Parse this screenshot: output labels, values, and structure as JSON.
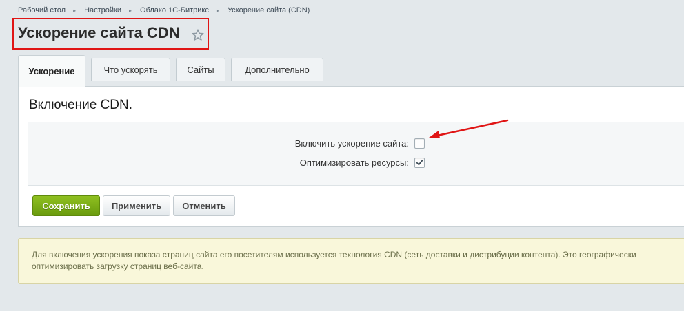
{
  "breadcrumb": {
    "items": [
      "Рабочий стол",
      "Настройки",
      "Облако 1С-Битрикс",
      "Ускорение сайта (CDN)"
    ],
    "separator": "▸"
  },
  "page_title": "Ускорение сайта CDN",
  "icons": {
    "favorite": "star-icon",
    "checkmark": "checkmark-icon",
    "annotation": "red-arrow-annotation"
  },
  "tabs": [
    {
      "label": "Ускорение",
      "active": true
    },
    {
      "label": "Что ускорять",
      "active": false
    },
    {
      "label": "Сайты",
      "active": false
    },
    {
      "label": "Дополнительно",
      "active": false
    }
  ],
  "section_title": "Включение CDN.",
  "options": [
    {
      "label": "Включить ускорение сайта:",
      "checked": false
    },
    {
      "label": "Оптимизировать ресурсы:",
      "checked": true
    }
  ],
  "buttons": {
    "save": "Сохранить",
    "apply": "Применить",
    "cancel": "Отменить"
  },
  "note": {
    "line1": "Для включения ускорения показа страниц сайта его посетителям используется технология CDN (сеть доставки и дистрибуции контента). Это географически",
    "line2": "оптимизировать загрузку страниц веб-сайта."
  },
  "colors": {
    "highlight_box": "#e01515",
    "save_button": "#7aab14",
    "note_background": "#f9f7da"
  }
}
